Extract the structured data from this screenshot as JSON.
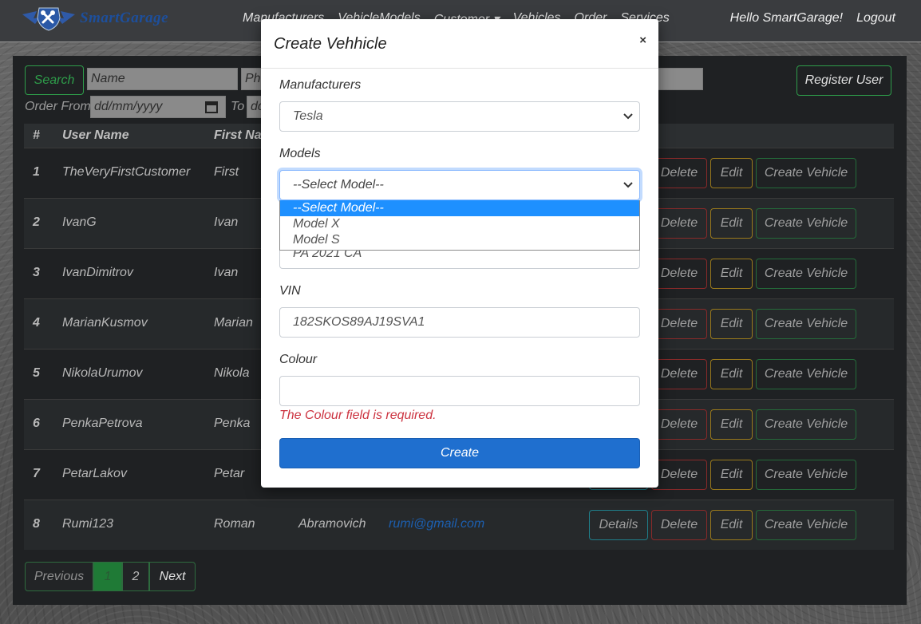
{
  "navbar": {
    "brand": "SmartGarage",
    "links": [
      "Manufacturers",
      "VehicleModels",
      "Customer ▾",
      "Vehicles",
      "Order",
      "Services"
    ],
    "greeting": "Hello SmartGarage!",
    "logout": "Logout"
  },
  "filters": {
    "search_label": "Search",
    "name_placeholder": "Name",
    "phone_placeholder": "Ph",
    "order_from_label": "Order From",
    "date_from_placeholder": "dd/mm/yyyy",
    "to_label": "To",
    "date_to_placeholder": "dd",
    "register_label": "Register User"
  },
  "table": {
    "headers": [
      "#",
      "User Name",
      "First Nam"
    ],
    "rows": [
      {
        "num": "1",
        "username": "TheVeryFirstCustomer",
        "first": "First",
        "last": "",
        "email": ""
      },
      {
        "num": "2",
        "username": "IvanG",
        "first": "Ivan",
        "last": "",
        "email": ""
      },
      {
        "num": "3",
        "username": "IvanDimitrov",
        "first": "Ivan",
        "last": "",
        "email": ""
      },
      {
        "num": "4",
        "username": "MarianKusmov",
        "first": "Marian",
        "last": "",
        "email": ""
      },
      {
        "num": "5",
        "username": "NikolaUrumov",
        "first": "Nikola",
        "last": "",
        "email": ""
      },
      {
        "num": "6",
        "username": "PenkaPetrova",
        "first": "Penka",
        "last": "",
        "email": ""
      },
      {
        "num": "7",
        "username": "PetarLakov",
        "first": "Petar",
        "last": "",
        "email": ""
      },
      {
        "num": "8",
        "username": "Rumi123",
        "first": "Roman",
        "last": "Abramovich",
        "email": "rumi@gmail.com"
      }
    ],
    "actions": {
      "details": "Details",
      "delete": "Delete",
      "edit": "Edit",
      "create_vehicle": "Create Vehicle"
    }
  },
  "pagination": {
    "previous": "Previous",
    "page1": "1",
    "page2": "2",
    "next": "Next"
  },
  "modal": {
    "title": "Create Vehhicle",
    "close": "×",
    "manufacturers_label": "Manufacturers",
    "manufacturer_value": "Tesla",
    "models_label": "Models",
    "model_value": "--Select Model--",
    "model_options": [
      "--Select Model--",
      "Model X",
      "Model S"
    ],
    "plate_value": "PA 2021 CA",
    "vin_label": "VIN",
    "vin_value": "182SKOS89AJ19SVA1",
    "colour_label": "Colour",
    "colour_value": "",
    "colour_error": "The Colour field is required.",
    "submit": "Create"
  },
  "colors": {
    "accent_green": "#2e9d4a",
    "primary_blue": "#1f6fcf",
    "error_red": "#cc3340"
  }
}
